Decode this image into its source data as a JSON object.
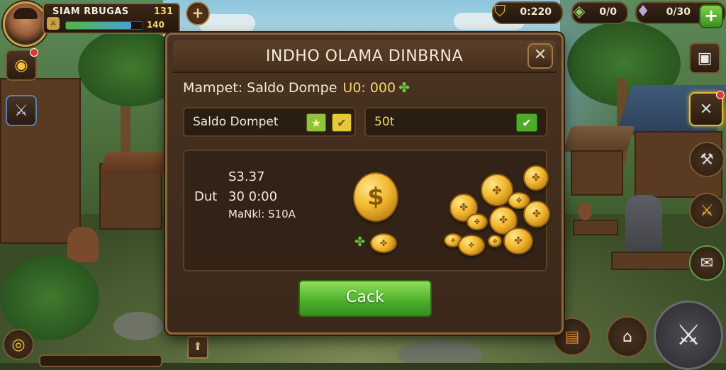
{
  "player": {
    "name": "SIAM RBUGAS",
    "gold": "131",
    "hp": "140",
    "hp_fraction": 0.85,
    "level_icon": "hero-badge-icon"
  },
  "resources": [
    {
      "icon": "shield-gold-icon",
      "value": "0:220"
    },
    {
      "icon": "gem-chest-icon",
      "value": "0/0"
    },
    {
      "icon": "crystal-icon",
      "value": "0/30"
    }
  ],
  "dialog": {
    "title": "INDHO OLAMA DINBRNA",
    "close_label": "✕",
    "wallet_label": "Mampet: Saldo Dompe",
    "wallet_amount": "U0: 000",
    "input_left": "Saldo Dompet",
    "input_right": "50t",
    "info_label": "Dut",
    "info_lines": [
      "S3.37",
      "30 0:00",
      "MaNkl: S10A"
    ],
    "big_coin_symbol": "$",
    "confirm_label": "Cack"
  },
  "colors": {
    "accent_gold": "#f4d56a",
    "confirm_green": "#4cad2a",
    "panel_brown": "#4a3322"
  },
  "icons": {
    "plus": "+",
    "star": "★",
    "check": "✔",
    "close": "✕",
    "clover": "✤",
    "up_arrow": "⬆"
  }
}
